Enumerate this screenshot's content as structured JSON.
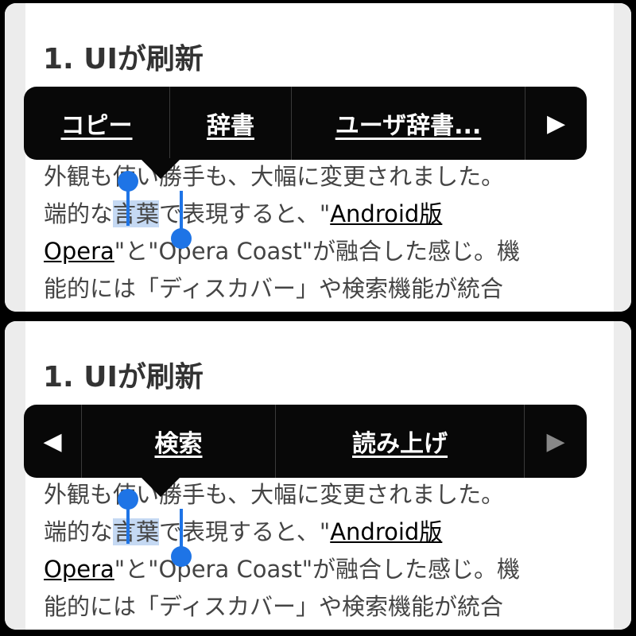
{
  "panels": [
    {
      "heading": "1. UIが刷新",
      "menu": {
        "items": [
          "コピー",
          "辞書",
          "ユーザ辞書..."
        ],
        "next_arrow": "▶"
      },
      "body": {
        "line1": "外観も使い勝手も、大幅に変更されました。",
        "line2_pre": "端的な",
        "line2_sel": "言葉",
        "line2_mid": "で表現すると、\"",
        "link1_a": "Android版",
        "link1_b": "Opera",
        "line3_mid": "\"と\"Opera Coast\"が融合した感じ。機",
        "line4": "能的には「ディスカバー」や検索機能が統合"
      }
    },
    {
      "heading": "1. UIが刷新",
      "menu": {
        "prev_arrow": "◀",
        "items": [
          "検索",
          "読み上げ"
        ],
        "next_arrow": "▶"
      },
      "body": {
        "line1": "外観も使い勝手も、大幅に変更されました。",
        "line2_pre": "端的な",
        "line2_sel": "言葉",
        "line2_mid": "で表現すると、\"",
        "link1_a": "Android版",
        "link1_b": "Opera",
        "line3_mid": "\"と\"Opera Coast\"が融合した感じ。機",
        "line4": "能的には「ディスカバー」や検索機能が統合"
      }
    }
  ],
  "colors": {
    "selection": "#c5d9f3",
    "handle": "#1e74e6",
    "menu_bg": "#080808"
  }
}
